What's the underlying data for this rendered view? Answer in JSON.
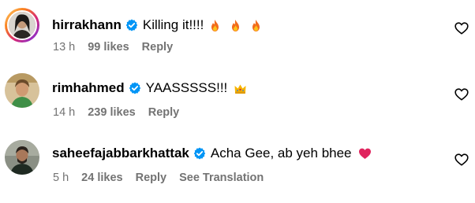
{
  "comments": [
    {
      "username": "hirrakhann",
      "text": "Killing it!!!!",
      "emojis": [
        "fire-emoji",
        "fire-emoji",
        "fire-emoji"
      ],
      "time": "13 h",
      "likes": "99 likes",
      "reply": "Reply",
      "translation": ""
    },
    {
      "username": "rimhahmed",
      "text": "YAASSSSS!!!",
      "emojis": [
        "crown-emoji"
      ],
      "time": "14 h",
      "likes": "239 likes",
      "reply": "Reply",
      "translation": ""
    },
    {
      "username": "saheefajabbarkhattak",
      "text": "Acha Gee, ab yeh bhee",
      "emojis": [
        "red-heart-emoji"
      ],
      "time": "5 h",
      "likes": "24 likes",
      "reply": "Reply",
      "translation": "See Translation"
    }
  ],
  "colors": {
    "text": "#000000",
    "meta": "#737373",
    "verified": "#0095f6",
    "heart_emoji": "#e0245e"
  }
}
